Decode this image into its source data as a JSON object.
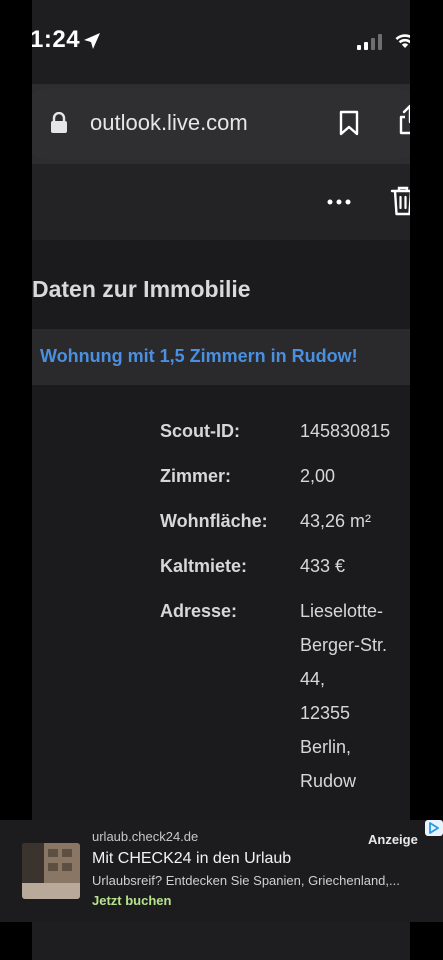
{
  "status_bar": {
    "time": "1:24",
    "icons": [
      "location-arrow-icon",
      "cellular-signal-icon",
      "wifi-icon"
    ]
  },
  "browser": {
    "url": "outlook.live.com",
    "icons": [
      "lock-icon",
      "bookmark-icon",
      "share-icon"
    ]
  },
  "mail_toolbar": {
    "icons": [
      "more-icon",
      "trash-icon"
    ]
  },
  "email": {
    "section_title": "Daten zur Immobilie",
    "listing_title": "Wohnung mit 1,5 Zimmern in Rudow!",
    "details": [
      {
        "label": "Scout-ID:",
        "value": "145830815"
      },
      {
        "label": "Zimmer:",
        "value": "2,00"
      },
      {
        "label": "Wohnfläche:",
        "value": "43,26 m²"
      },
      {
        "label": "Kaltmiete:",
        "value": "433 €"
      },
      {
        "label": "Adresse:",
        "value": ""
      }
    ],
    "address_lines": [
      "Lieselotte-",
      "Berger-Str.",
      "44,",
      "12355",
      "Berlin,",
      "Rudow"
    ]
  },
  "ad": {
    "domain": "urlaub.check24.de",
    "title": "Mit CHECK24 in den Urlaub",
    "description": "Urlaubsreif? Entdecken Sie Spanien, Griechenland,...",
    "cta": "Jetzt buchen",
    "badge": "Anzeige"
  },
  "colors": {
    "background": "#1e1e20",
    "link_blue": "#4b8fe0",
    "cta_green": "#b6e28c"
  }
}
